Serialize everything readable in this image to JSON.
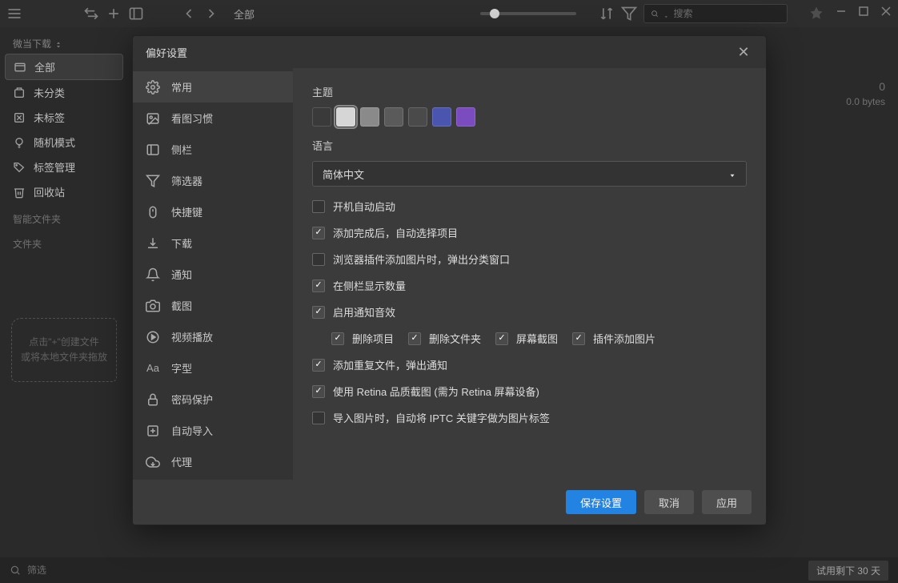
{
  "topbar": {
    "crumb": "全部",
    "search_placeholder": "搜索"
  },
  "sidebar": {
    "header": "微当下载",
    "items": [
      {
        "label": "全部"
      },
      {
        "label": "未分类"
      },
      {
        "label": "未标签"
      },
      {
        "label": "随机模式"
      },
      {
        "label": "标签管理"
      },
      {
        "label": "回收站"
      }
    ],
    "section_smart": "智能文件夹",
    "section_folder": "文件夹",
    "hint_line1": "点击\"+\"创建文件",
    "hint_line2": "或将本地文件夹拖放"
  },
  "maininfo": {
    "count": "0",
    "size": "0.0 bytes"
  },
  "bottombar": {
    "filter_placeholder": "筛选",
    "trial": "试用剩下 30 天"
  },
  "modal": {
    "title": "偏好设置",
    "nav": [
      {
        "label": "常用"
      },
      {
        "label": "看图习惯"
      },
      {
        "label": "侧栏"
      },
      {
        "label": "筛选器"
      },
      {
        "label": "快捷键"
      },
      {
        "label": "下载"
      },
      {
        "label": "通知"
      },
      {
        "label": "截图"
      },
      {
        "label": "视频播放"
      },
      {
        "label": "字型"
      },
      {
        "label": "密码保护"
      },
      {
        "label": "自动导入"
      },
      {
        "label": "代理"
      }
    ],
    "theme_label": "主题",
    "themes": [
      "#3a3a3a",
      "#d6d6d6",
      "#8a8a8a",
      "#5a5a5a",
      "#4a4a4a",
      "#4a55b0",
      "#7b4bc0"
    ],
    "language_label": "语言",
    "language_value": "简体中文",
    "checks": {
      "auto_start": "开机自动启动",
      "auto_select": "添加完成后，自动选择项目",
      "popup_cat": "浏览器插件添加图片时，弹出分类窗口",
      "show_count": "在侧栏显示数量",
      "notify_sound": "启用通知音效",
      "sub_delete": "删除项目",
      "sub_delete_folder": "删除文件夹",
      "sub_screenshot": "屏幕截图",
      "sub_plugin": "插件添加图片",
      "dup_notify": "添加重复文件，弹出通知",
      "retina": "使用 Retina 品质截图 (需为 Retina 屏幕设备)",
      "iptc": "导入图片时，自动将 IPTC 关键字做为图片标签"
    },
    "footer": {
      "save": "保存设置",
      "cancel": "取消",
      "apply": "应用"
    }
  }
}
